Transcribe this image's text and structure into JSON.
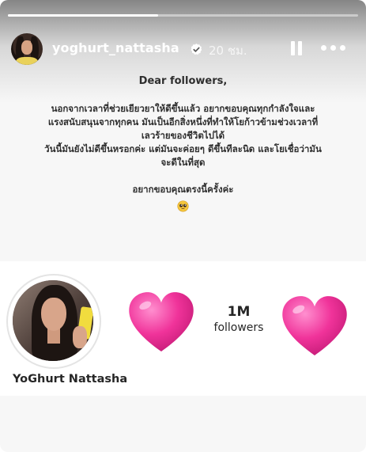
{
  "story": {
    "progress_fraction": 0.43,
    "username": "yoghurt_nattasha",
    "time_ago": "20 ชม.",
    "verified": true
  },
  "letter": {
    "greeting": "Dear followers,",
    "lines": [
      "นอกจากเวลาที่ช่วยเยียวยาให้ดีขึ้นแล้ว อยากขอบคุณทุกกำลังใจและ",
      "แรงสนับสนุนจากทุกคน มันเป็นอีกสิ่งหนึ่งที่ทำให้โยก้าวข้ามช่วงเวลาที่",
      "เลวร้ายของชีวิตไปได้",
      "วันนี้มันยังไม่ดีขึ้นหรอกค่ะ แต่มันจะค่อยๆ ดีขึ้นทีละนิด และโยเชื่อว่ามัน",
      "จะดีในที่สุด"
    ],
    "thanks": "อยากขอบคุณตรงนี้ครั้งค่ะ",
    "emoji": "pleading-face-emoji"
  },
  "milestone": {
    "display_name": "YoGhurt Nattasha",
    "follower_count": "1M",
    "follower_label": "followers",
    "heart_color": "#f0339a"
  },
  "colors": {
    "text": "#2e2e2e",
    "verified": "#ffffff"
  }
}
